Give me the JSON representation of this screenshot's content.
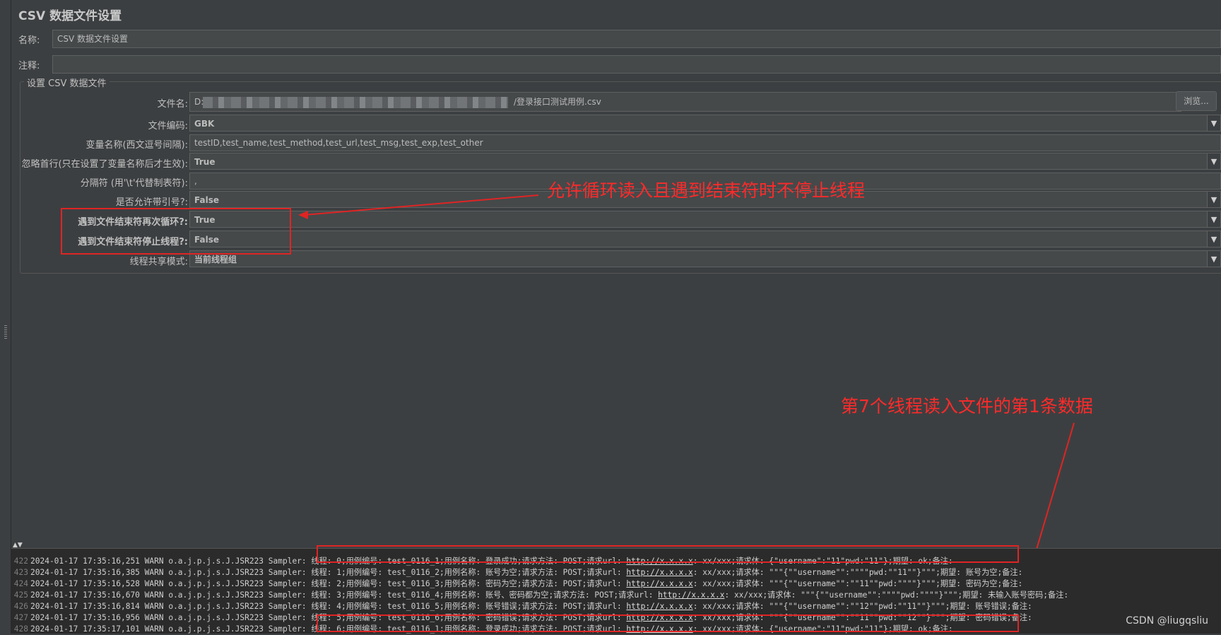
{
  "title": "CSV 数据文件设置",
  "name_label": "名称:",
  "name_value": "CSV 数据文件设置",
  "comment_label": "注释:",
  "comment_value": "",
  "group_title": "设置 CSV 数据文件",
  "browse_button": "浏览...",
  "fields": {
    "filename": {
      "label": "文件名:",
      "prefix": "D:",
      "suffix": "/登录接口测试用例.csv"
    },
    "encoding": {
      "label": "文件编码:",
      "value": "GBK"
    },
    "varnames": {
      "label": "变量名称(西文逗号间隔):",
      "value": "testID,test_name,test_method,test_url,test_msg,test_exp,test_other"
    },
    "ignore_first": {
      "label": "忽略首行(只在设置了变量名称后才生效):",
      "value": "True"
    },
    "delimiter": {
      "label": "分隔符 (用'\\t'代替制表符):",
      "value": ","
    },
    "quoted": {
      "label": "是否允许带引号?:",
      "value": "False"
    },
    "recycle": {
      "label": "遇到文件结束符再次循环?:",
      "value": "True"
    },
    "stop_thread": {
      "label": "遇到文件结束符停止线程?:",
      "value": "False"
    },
    "share_mode": {
      "label": "线程共享模式:",
      "value": "当前线程组"
    }
  },
  "annotations": {
    "top": "允许循环读入且遇到结束符时不停止线程",
    "bottom": "第7个线程读入文件的第1条数据"
  },
  "log_lines": [
    {
      "num": "422",
      "pre": "2024-01-17 17:35:16,251 WARN o.a.j.p.j.s.J.JSR223 Sampler: 线程: 0;用例编号: test_0116_1;用例名称: 登录成功;请求方法: POST;请求url: ",
      "url": "http://x.x.x.x",
      "post": ": xx/xxx;请求体: {\"username\":\"11\"pwd:\"11\"};期望: ok;备注:"
    },
    {
      "num": "423",
      "pre": "2024-01-17 17:35:16,385 WARN o.a.j.p.j.s.J.JSR223 Sampler: 线程: 1;用例编号: test_0116_2;用例名称: 账号为空;请求方法: POST;请求url: ",
      "url": "http://x.x.x.x",
      "post": ": xx/xxx;请求体: \"\"\"{\"\"username\"\":\"\"\"\"pwd:\"\"11\"\"}\"\"\";期望: 账号为空;备注:"
    },
    {
      "num": "424",
      "pre": "2024-01-17 17:35:16,528 WARN o.a.j.p.j.s.J.JSR223 Sampler: 线程: 2;用例编号: test_0116_3;用例名称: 密码为空;请求方法: POST;请求url: ",
      "url": "http://x.x.x.x",
      "post": ": xx/xxx;请求体: \"\"\"{\"\"username\"\":\"\"11\"\"pwd:\"\"\"\"}\"\"\";期望: 密码为空;备注:"
    },
    {
      "num": "425",
      "pre": "2024-01-17 17:35:16,670 WARN o.a.j.p.j.s.J.JSR223 Sampler: 线程: 3;用例编号: test_0116_4;用例名称: 账号、密码都为空;请求方法: POST;请求url: ",
      "url": "http://x.x.x.x",
      "post": ": xx/xxx;请求体: \"\"\"{\"\"username\"\":\"\"\"\"pwd:\"\"\"\"}\"\"\";期望: 未输入账号密码;备注:"
    },
    {
      "num": "426",
      "pre": "2024-01-17 17:35:16,814 WARN o.a.j.p.j.s.J.JSR223 Sampler: 线程: 4;用例编号: test_0116_5;用例名称: 账号错误;请求方法: POST;请求url: ",
      "url": "http://x.x.x.x",
      "post": ": xx/xxx;请求体: \"\"\"{\"\"username\"\":\"\"12\"\"pwd:\"\"11\"\"}\"\"\";期望: 账号错误;备注:"
    },
    {
      "num": "427",
      "pre": "2024-01-17 17:35:16,956 WARN o.a.j.p.j.s.J.JSR223 Sampler: 线程: 5;用例编号: test_0116_6;用例名称: 密码错误;请求方法: POST;请求url: ",
      "url": "http://x.x.x.x",
      "post": ": xx/xxx;请求体: \"\"\"{\"\"username\"\":\"\"11\"\"pwd:\"\"12\"\"}\"\"\";期望: 密码错误;备注:"
    },
    {
      "num": "428",
      "pre": "2024-01-17 17:35:17,101 WARN o.a.j.p.j.s.J.JSR223 Sampler: 线程: 6;用例编号: test_0116_1;用例名称: 登录成功;请求方法: POST;请求url: ",
      "url": "http://x.x.x.x",
      "post": ": xx/xxx;请求体: {\"username\":\"11\"pwd:\"11\"};期望: ok;备注:"
    }
  ],
  "watermark": "CSDN @liugqsliu"
}
